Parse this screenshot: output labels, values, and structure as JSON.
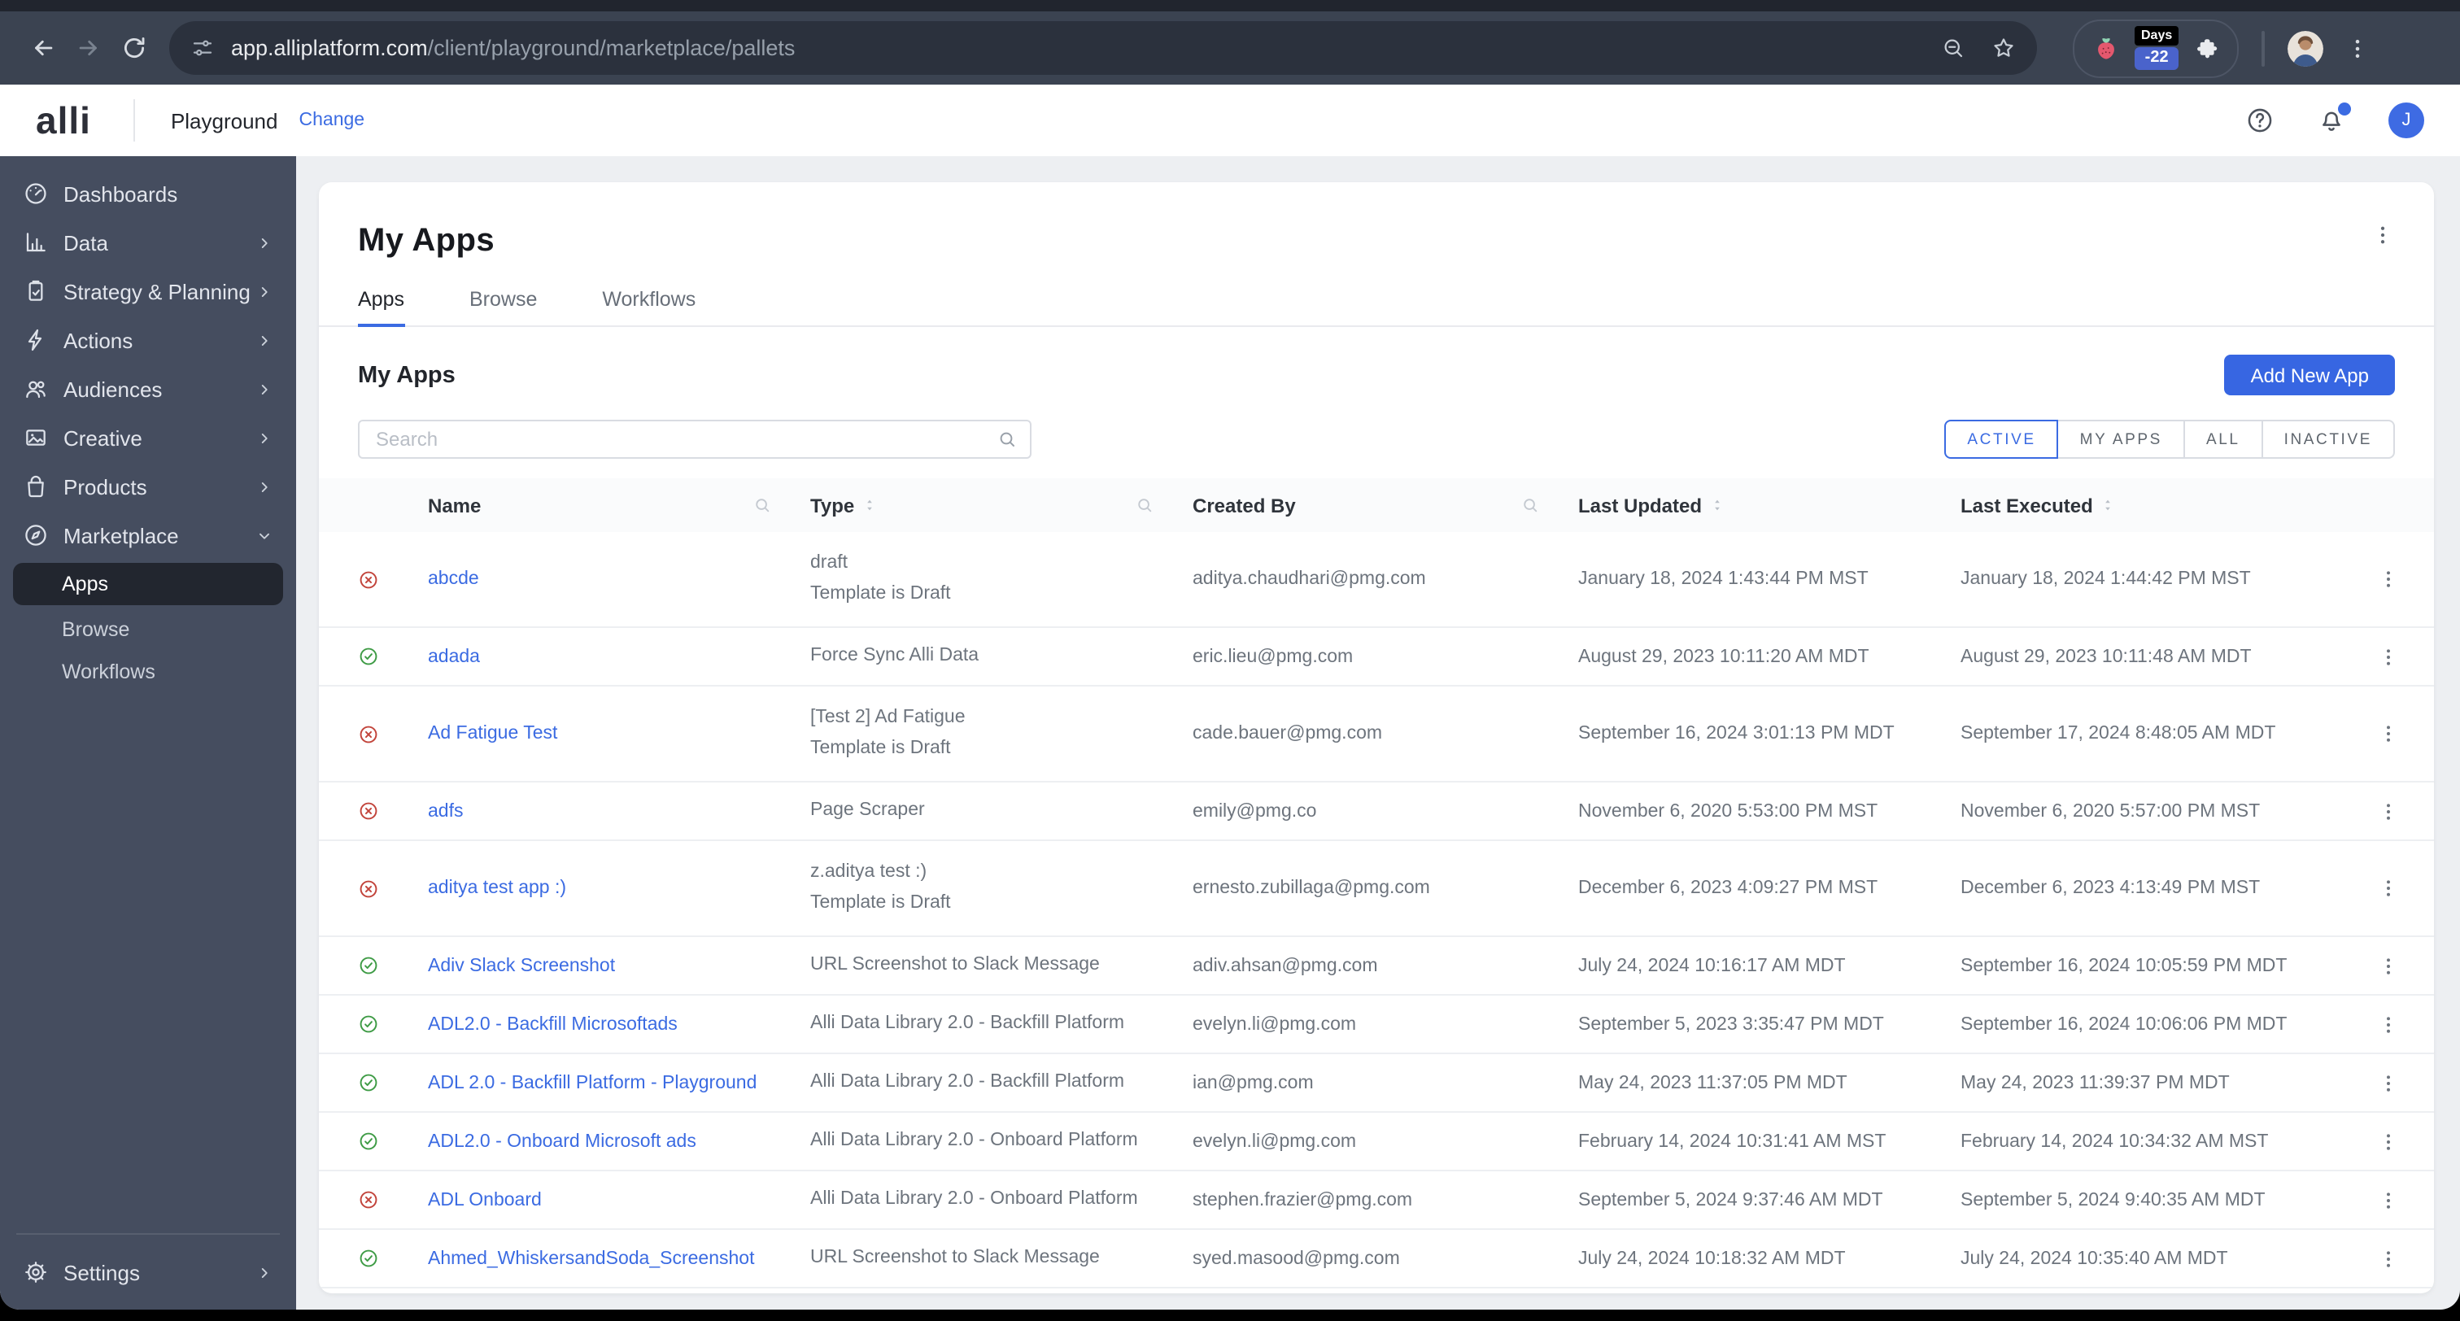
{
  "browser": {
    "url_host": "app.alliplatform.com",
    "url_path": "/client/playground/marketplace/pallets",
    "extension_badge": {
      "label": "Days",
      "value": "-22"
    }
  },
  "header": {
    "logo": "alli",
    "client_name": "Playground",
    "change_label": "Change",
    "avatar_initial": "J"
  },
  "sidebar": {
    "items": [
      {
        "label": "Dashboards",
        "icon": "gauge",
        "chevron": "none"
      },
      {
        "label": "Data",
        "icon": "chart",
        "chevron": "right"
      },
      {
        "label": "Strategy & Planning",
        "icon": "clipboard",
        "chevron": "right"
      },
      {
        "label": "Actions",
        "icon": "bolt",
        "chevron": "right"
      },
      {
        "label": "Audiences",
        "icon": "people",
        "chevron": "right"
      },
      {
        "label": "Creative",
        "icon": "image",
        "chevron": "right"
      },
      {
        "label": "Products",
        "icon": "bag",
        "chevron": "right"
      },
      {
        "label": "Marketplace",
        "icon": "compass",
        "chevron": "down"
      }
    ],
    "sub_items": [
      {
        "label": "Apps",
        "selected": true
      },
      {
        "label": "Browse",
        "selected": false
      },
      {
        "label": "Workflows",
        "selected": false
      }
    ],
    "settings_label": "Settings"
  },
  "page": {
    "title": "My Apps",
    "tabs": [
      "Apps",
      "Browse",
      "Workflows"
    ],
    "active_tab": "Apps",
    "section_title": "My Apps",
    "add_button": "Add New App",
    "search_placeholder": "Search",
    "filters": [
      "ACTIVE",
      "MY APPS",
      "ALL",
      "INACTIVE"
    ],
    "active_filter": "ACTIVE"
  },
  "table": {
    "columns": [
      {
        "label": "Name",
        "sortable": false,
        "searchable": true
      },
      {
        "label": "Type",
        "sortable": true,
        "searchable": true
      },
      {
        "label": "Created By",
        "sortable": false,
        "searchable": true
      },
      {
        "label": "Last Updated",
        "sortable": true,
        "searchable": false
      },
      {
        "label": "Last Executed",
        "sortable": true,
        "searchable": false
      }
    ],
    "rows": [
      {
        "status": "error",
        "name": "abcde",
        "type_lines": [
          "draft",
          "Template is Draft"
        ],
        "created_by": "aditya.chaudhari@pmg.com",
        "last_updated": "January 18, 2024 1:43:44 PM MST",
        "last_executed": "January 18, 2024 1:44:42 PM MST"
      },
      {
        "status": "success",
        "name": "adada",
        "type_lines": [
          "Force Sync Alli Data"
        ],
        "created_by": "eric.lieu@pmg.com",
        "last_updated": "August 29, 2023 10:11:20 AM MDT",
        "last_executed": "August 29, 2023 10:11:48 AM MDT"
      },
      {
        "status": "error",
        "name": "Ad Fatigue Test",
        "type_lines": [
          "[Test 2] Ad Fatigue",
          "Template is Draft"
        ],
        "created_by": "cade.bauer@pmg.com",
        "last_updated": "September 16, 2024 3:01:13 PM MDT",
        "last_executed": "September 17, 2024 8:48:05 AM MDT"
      },
      {
        "status": "error",
        "name": "adfs",
        "type_lines": [
          "Page Scraper"
        ],
        "created_by": "emily@pmg.co",
        "last_updated": "November 6, 2020 5:53:00 PM MST",
        "last_executed": "November 6, 2020 5:57:00 PM MST"
      },
      {
        "status": "error",
        "name": "aditya test app :)",
        "type_lines": [
          "z.aditya test :)",
          "Template is Draft"
        ],
        "created_by": "ernesto.zubillaga@pmg.com",
        "last_updated": "December 6, 2023 4:09:27 PM MST",
        "last_executed": "December 6, 2023 4:13:49 PM MST"
      },
      {
        "status": "success",
        "name": "Adiv Slack Screenshot",
        "type_lines": [
          "URL Screenshot to Slack Message"
        ],
        "created_by": "adiv.ahsan@pmg.com",
        "last_updated": "July 24, 2024 10:16:17 AM MDT",
        "last_executed": "September 16, 2024 10:05:59 PM MDT"
      },
      {
        "status": "success",
        "name": "ADL2.0 - Backfill Microsoftads",
        "type_lines": [
          "Alli Data Library 2.0 - Backfill Platform"
        ],
        "created_by": "evelyn.li@pmg.com",
        "last_updated": "September 5, 2023 3:35:47 PM MDT",
        "last_executed": "September 16, 2024 10:06:06 PM MDT"
      },
      {
        "status": "success",
        "name": "ADL 2.0 - Backfill Platform - Playground",
        "type_lines": [
          "Alli Data Library 2.0 - Backfill Platform"
        ],
        "created_by": "ian@pmg.com",
        "last_updated": "May 24, 2023 11:37:05 PM MDT",
        "last_executed": "May 24, 2023 11:39:37 PM MDT"
      },
      {
        "status": "success",
        "name": "ADL2.0 - Onboard Microsoft ads",
        "type_lines": [
          "Alli Data Library 2.0 - Onboard Platform"
        ],
        "created_by": "evelyn.li@pmg.com",
        "last_updated": "February 14, 2024 10:31:41 AM MST",
        "last_executed": "February 14, 2024 10:34:32 AM MST"
      },
      {
        "status": "error",
        "name": "ADL Onboard",
        "type_lines": [
          "Alli Data Library 2.0 - Onboard Platform"
        ],
        "created_by": "stephen.frazier@pmg.com",
        "last_updated": "September 5, 2024 9:37:46 AM MDT",
        "last_executed": "September 5, 2024 9:40:35 AM MDT"
      },
      {
        "status": "success",
        "name": "Ahmed_WhiskersandSoda_Screenshot",
        "type_lines": [
          "URL Screenshot to Slack Message"
        ],
        "created_by": "syed.masood@pmg.com",
        "last_updated": "July 24, 2024 10:18:32 AM MDT",
        "last_executed": "July 24, 2024 10:35:40 AM MDT"
      }
    ]
  },
  "colors": {
    "accent_blue": "#3b6be2",
    "status_green": "#3e9b45",
    "status_red": "#c2443b",
    "sidebar_bg": "#454d5f",
    "chrome_bg": "#3b4351"
  }
}
